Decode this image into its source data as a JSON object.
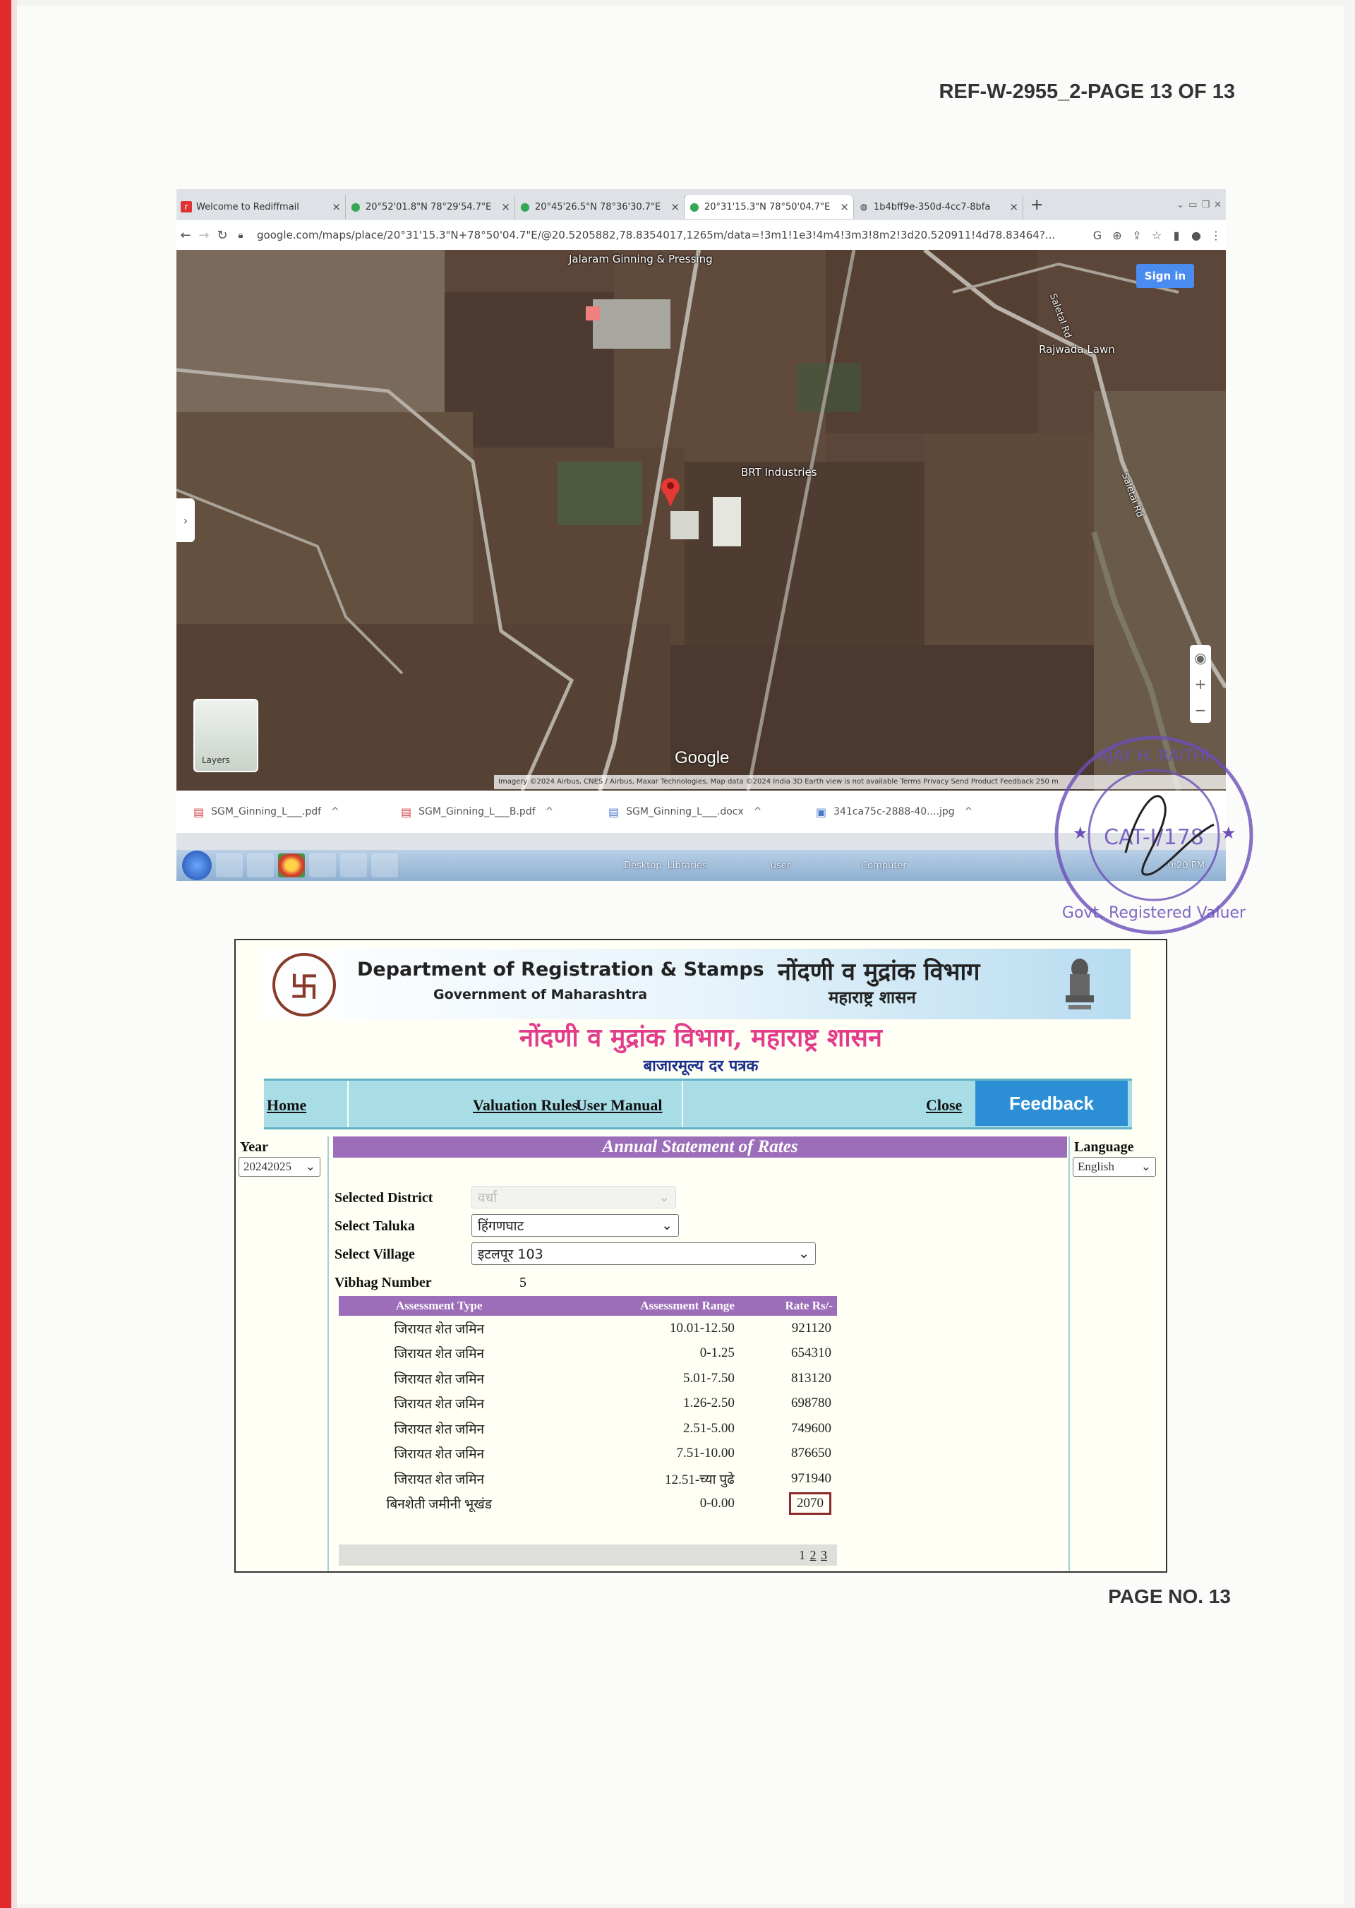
{
  "document": {
    "ref": "REF-W-2955_2-PAGE 13 OF 13",
    "page_no": "PAGE NO. 13"
  },
  "browser": {
    "tabs": [
      {
        "title": "Welcome to Rediffmail",
        "icon": "rediff-icon"
      },
      {
        "title": "20°52'01.8\"N 78°29'54.7\"E",
        "icon": "map-pin-icon"
      },
      {
        "title": "20°45'26.5\"N 78°36'30.7\"E",
        "icon": "map-pin-icon"
      },
      {
        "title": "20°31'15.3\"N 78°50'04.7\"E",
        "icon": "map-pin-icon"
      },
      {
        "title": "1b4bff9e-350d-4cc7-8bfa",
        "icon": "globe-icon"
      }
    ],
    "url": "google.com/maps/place/20°31'15.3\"N+78°50'04.7\"E/@20.5205882,78.8354017,1265m/data=!3m1!1e3!4m4!3m3!8m2!3d20.520911!4d78.83464?...",
    "map": {
      "sign_in": "Sign in",
      "labels": [
        "Jalaram Ginning & Pressing",
        "Rajwada Lawn",
        "BRT Industries",
        "Saletal Rd",
        "Saletal Rd"
      ],
      "layers": "Layers",
      "logo": "Google",
      "attribution": "Imagery ©2024 Airbus, CNES / Airbus, Maxar Technologies, Map data ©2024   India   3D Earth view is not available   Terms   Privacy   Send Product Feedback   250 m"
    },
    "downloads": [
      "SGM_Ginning_L___.pdf",
      "SGM_Ginning_L___B.pdf",
      "SGM_Ginning_L___.docx",
      "341ca75c-2888-40....jpg"
    ],
    "taskbar": [
      "Desktop",
      "Libraries",
      "user",
      "Computer",
      "0:20 PM"
    ]
  },
  "stamp": {
    "text": "AJAY H. RAITHI · CAT-I/178 · Govt. Registered Valuer"
  },
  "igr": {
    "dept_en": "Department of Registration & Stamps",
    "gov_en": "Government of Maharashtra",
    "dept_mr": "नोंदणी व मुद्रांक विभाग",
    "gov_mr": "महाराष्ट्र शासन",
    "title": "नोंदणी व मुद्रांक विभाग, महाराष्ट्र शासन",
    "subtitle": "बाजारमूल्य दर पत्रक",
    "nav": {
      "home": "Home",
      "valuation_rules": "Valuation Rules",
      "user_manual": "User Manual",
      "close": "Close",
      "feedback": "Feedback"
    },
    "year_label": "Year",
    "year_value": "20242025",
    "language_label": "Language",
    "language_value": "English",
    "heading": "Annual Statement of Rates",
    "form": {
      "district_label": "Selected District",
      "district_value": "वर्धा",
      "taluka_label": "Select Taluka",
      "taluka_value": "हिंगणघाट",
      "village_label": "Select Village",
      "village_value": "इटलपूर 103",
      "vibhag_label": "Vibhag Number",
      "vibhag_value": "5"
    },
    "table": {
      "headers": [
        "Assessment Type",
        "Assessment Range",
        "Rate Rs/-"
      ],
      "rows": [
        [
          "जिरायत शेत जमिन",
          "10.01-12.50",
          "921120"
        ],
        [
          "जिरायत शेत जमिन",
          "0-1.25",
          "654310"
        ],
        [
          "जिरायत शेत जमिन",
          "5.01-7.50",
          "813120"
        ],
        [
          "जिरायत शेत जमिन",
          "1.26-2.50",
          "698780"
        ],
        [
          "जिरायत शेत जमिन",
          "2.51-5.00",
          "749600"
        ],
        [
          "जिरायत शेत जमिन",
          "7.51-10.00",
          "876650"
        ],
        [
          "जिरायत शेत जमिन",
          "12.51-च्या पुढे",
          "971940"
        ],
        [
          "बिनशेती जमीनी भूखंड",
          "0-0.00",
          "2070"
        ]
      ],
      "highlighted_row": 7
    },
    "pager": {
      "current": "1",
      "links": [
        "2",
        "3"
      ]
    }
  }
}
